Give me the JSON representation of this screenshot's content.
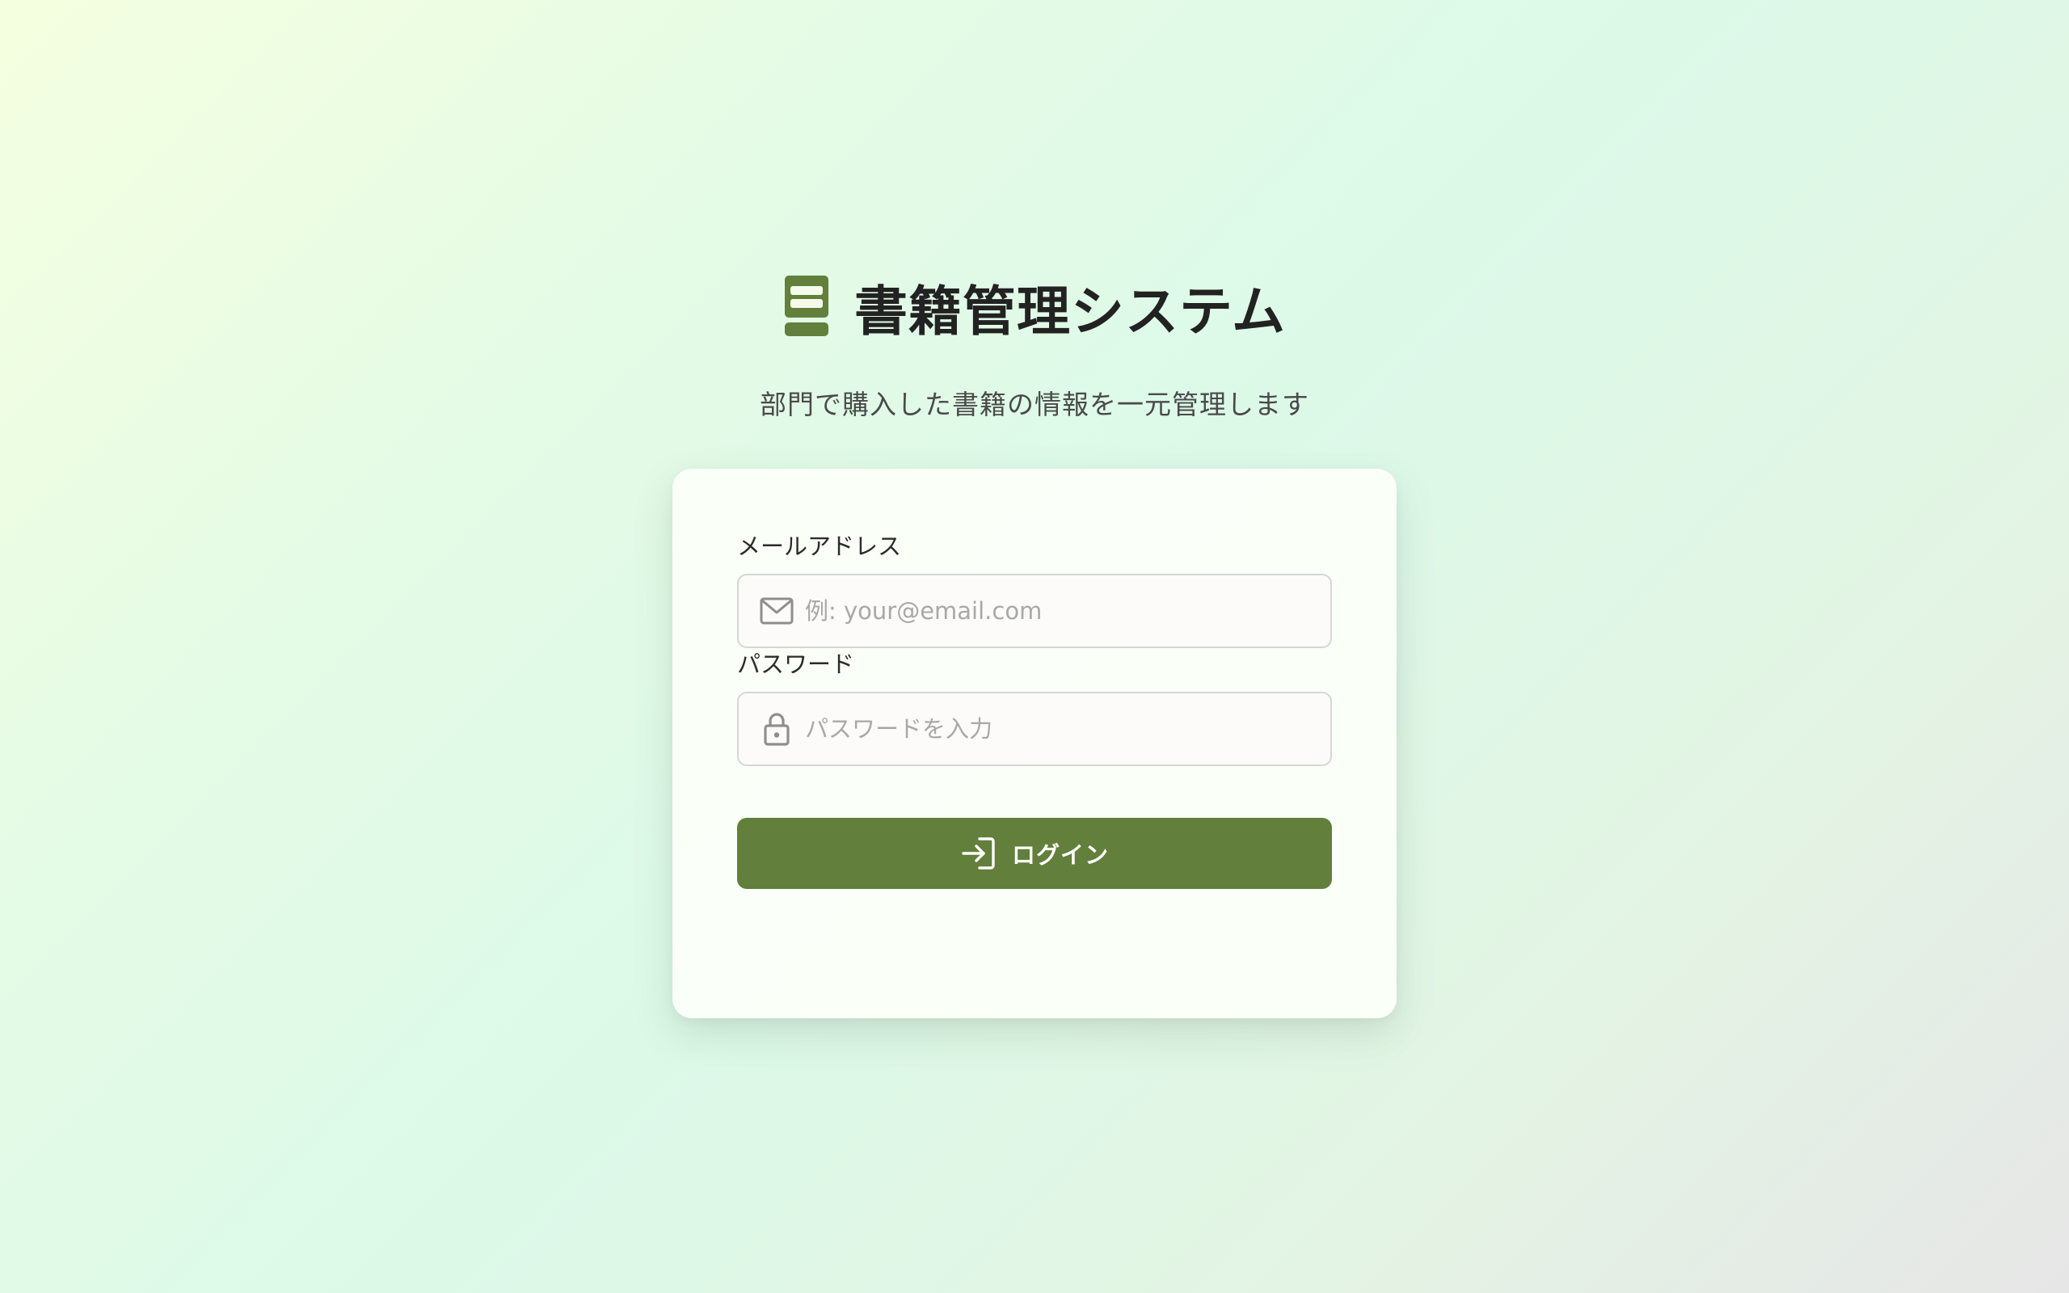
{
  "header": {
    "logo_icon": "book-stack-icon",
    "title": "書籍管理システム",
    "subtitle": "部門で購入した書籍の情報を一元管理します"
  },
  "login_form": {
    "email": {
      "label": "メールアドレス",
      "placeholder": "例: your@email.com",
      "value": "",
      "icon": "mail-icon"
    },
    "password": {
      "label": "パスワード",
      "placeholder": "パスワードを入力",
      "value": "",
      "icon": "lock-icon"
    },
    "submit": {
      "label": "ログイン",
      "icon": "login-icon"
    }
  },
  "colors": {
    "accent": "#627f3b",
    "title_text": "#222222",
    "placeholder": "#a8a8a8"
  }
}
